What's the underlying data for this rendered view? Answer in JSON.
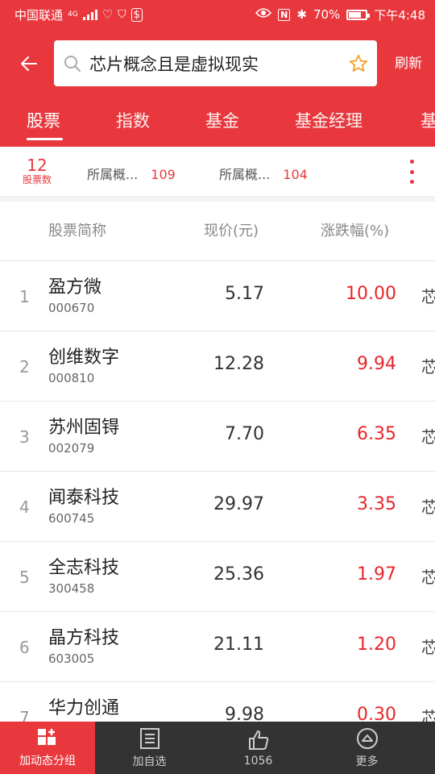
{
  "status_bar": {
    "carrier": "中国联通",
    "network": "4G",
    "battery": "70%",
    "time": "下午4:48"
  },
  "header": {
    "back_icon": "back-arrow-icon",
    "search_query": "芯片概念且是虚拟现实",
    "refresh_label": "刷新"
  },
  "tabs": [
    {
      "label": "股票",
      "active": true
    },
    {
      "label": "指数",
      "active": false
    },
    {
      "label": "基金",
      "active": false
    },
    {
      "label": "基金经理",
      "active": false
    },
    {
      "label": "基",
      "active": false
    }
  ],
  "filter": {
    "count": "12",
    "count_label": "股票数",
    "chips": [
      {
        "label": "所属概...",
        "count": "109"
      },
      {
        "label": "所属概...",
        "count": "104"
      }
    ]
  },
  "table": {
    "columns": [
      "股票简称",
      "现价(元)",
      "涨跌幅(%)"
    ],
    "rows": [
      {
        "index": "1",
        "name": "盈方微",
        "code": "000670",
        "price": "5.17",
        "change": "10.00",
        "extra": "芯"
      },
      {
        "index": "2",
        "name": "创维数字",
        "code": "000810",
        "price": "12.28",
        "change": "9.94",
        "extra": "芯"
      },
      {
        "index": "3",
        "name": "苏州固锝",
        "code": "002079",
        "price": "7.70",
        "change": "6.35",
        "extra": "芯"
      },
      {
        "index": "4",
        "name": "闻泰科技",
        "code": "600745",
        "price": "29.97",
        "change": "3.35",
        "extra": "芯"
      },
      {
        "index": "5",
        "name": "全志科技",
        "code": "300458",
        "price": "25.36",
        "change": "1.97",
        "extra": "芯"
      },
      {
        "index": "6",
        "name": "晶方科技",
        "code": "603005",
        "price": "21.11",
        "change": "1.20",
        "extra": "芯"
      },
      {
        "index": "7",
        "name": "华力创通",
        "code": "",
        "price": "9.98",
        "change": "0.30",
        "extra": "芯"
      }
    ]
  },
  "bottom_bar": [
    {
      "label": "加动态分组",
      "icon": "grid-add-icon"
    },
    {
      "label": "加自选",
      "icon": "list-icon"
    },
    {
      "label": "1056",
      "icon": "thumbs-up-icon"
    },
    {
      "label": "更多",
      "icon": "more-circle-icon"
    }
  ],
  "colors": {
    "brand_red": "#e8383d",
    "rise_red": "#e8262b",
    "bottom_bg": "#333333"
  }
}
